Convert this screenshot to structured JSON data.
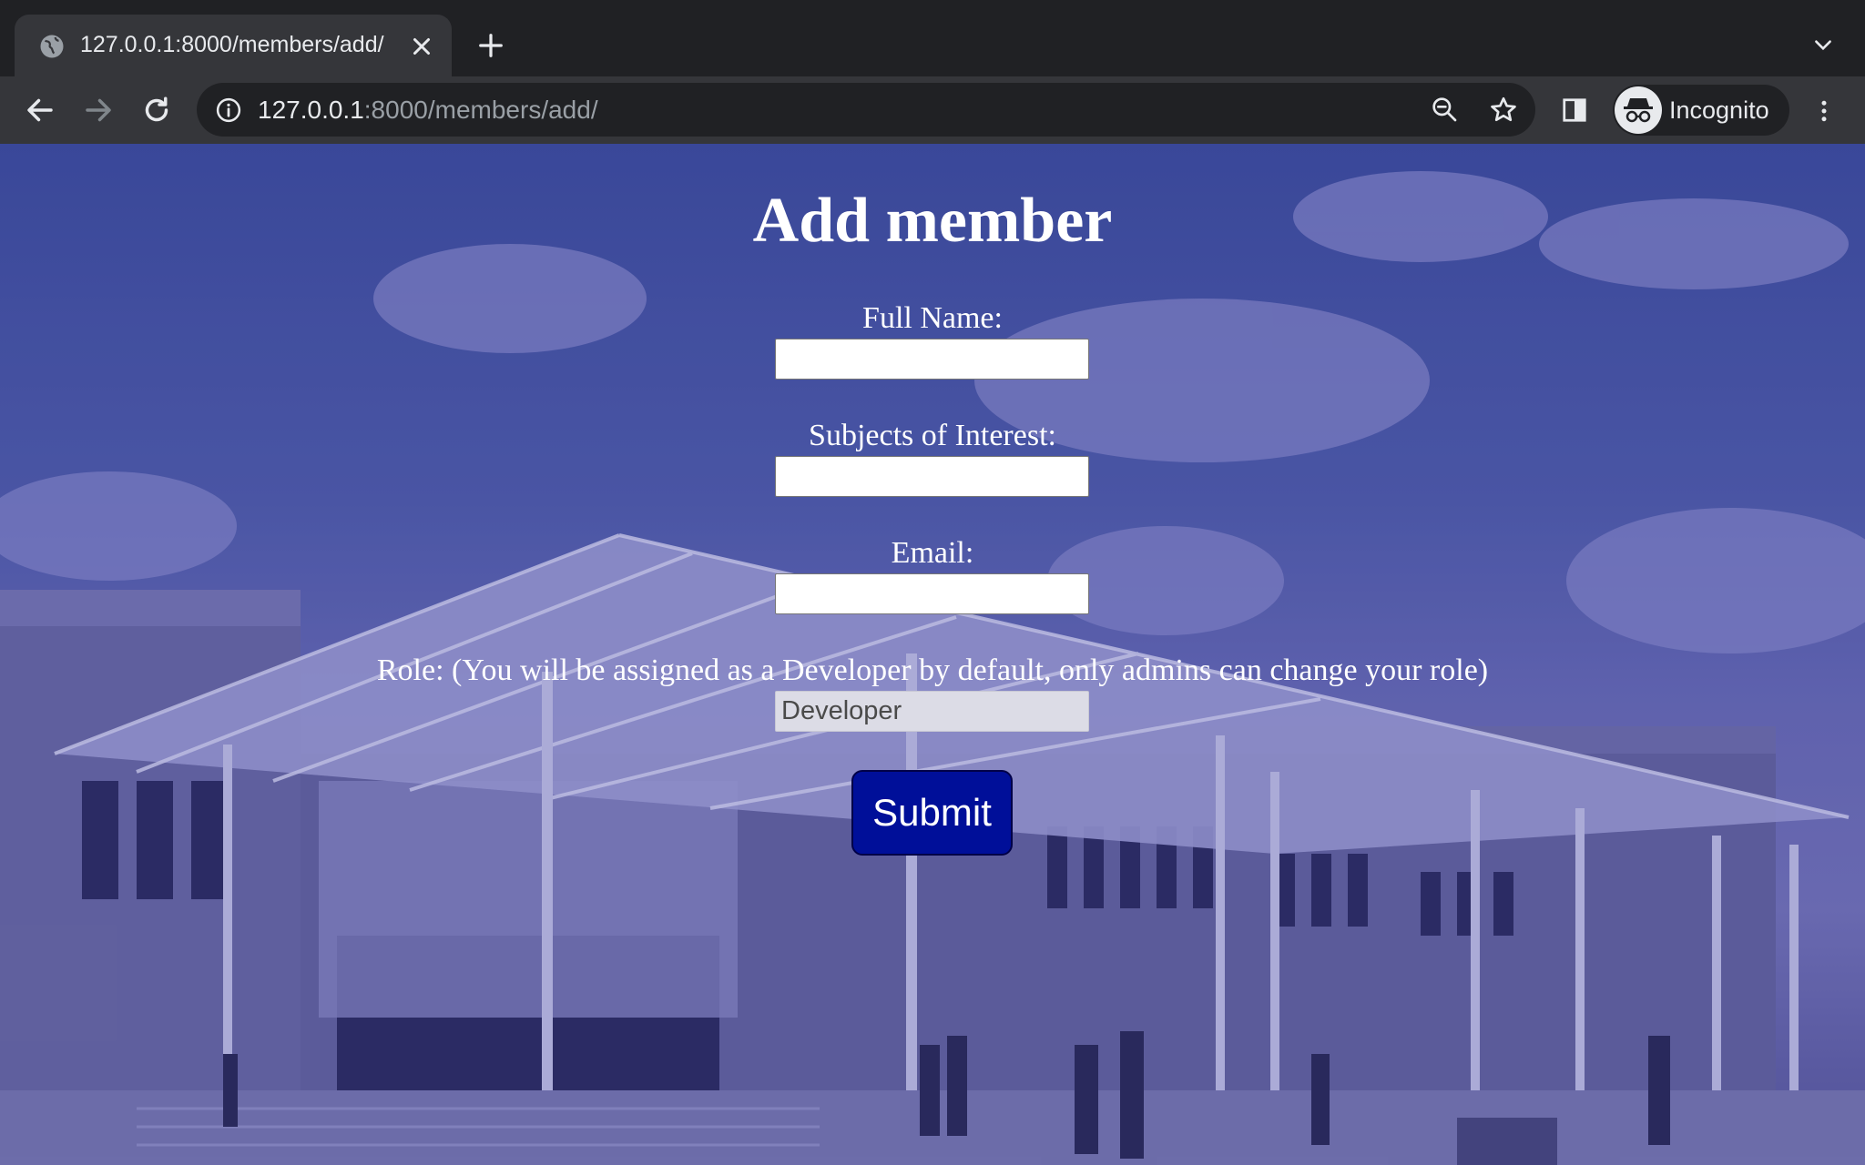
{
  "browser": {
    "tab_title": "127.0.0.1:8000/members/add/",
    "url_host": "127.0.0.1",
    "url_rest": ":8000/members/add/",
    "profile_label": "Incognito",
    "icons": [
      "globe-icon",
      "close-icon",
      "plus-icon",
      "chevron-down-icon",
      "back-arrow-icon",
      "forward-arrow-icon",
      "reload-icon",
      "info-icon",
      "zoom-icon",
      "star-icon",
      "side-panel-icon",
      "incognito-icon",
      "kebab-menu-icon"
    ]
  },
  "page": {
    "title": "Add member",
    "fields": [
      {
        "label": "Full Name:",
        "value": ""
      },
      {
        "label": "Subjects of Interest:",
        "value": ""
      },
      {
        "label": "Email:",
        "value": ""
      },
      {
        "label": "Role: (You will be assigned as a Developer by default, only admins can change your role)",
        "value": "Developer"
      }
    ],
    "submit_label": "Submit"
  },
  "colors": {
    "chrome_dark": "#202124",
    "chrome_toolbar": "#35363a",
    "button_bg": "#000f99",
    "overlay_tint": "#3e4f9a"
  }
}
